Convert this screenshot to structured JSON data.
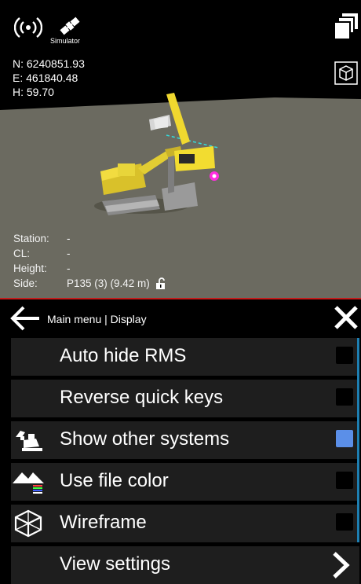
{
  "status": {
    "simulator_label": "Simulator"
  },
  "coords": {
    "n": "N: 6240851.93",
    "e": "E: 461840.48",
    "h": "H: 59.70"
  },
  "info": {
    "station_key": "Station:",
    "station_val": "-",
    "cl_key": "CL:",
    "cl_val": "-",
    "height_key": "Height:",
    "height_val": "-",
    "side_key": "Side:",
    "side_val": "P135 (3) (9.42 m)"
  },
  "menu": {
    "breadcrumb": "Main menu | Display",
    "items": [
      {
        "label": "Auto hide RMS",
        "checked": false
      },
      {
        "label": "Reverse quick keys",
        "checked": false
      },
      {
        "label": "Show other systems",
        "checked": true
      },
      {
        "label": "Use file color",
        "checked": false
      },
      {
        "label": "Wireframe",
        "checked": false
      },
      {
        "label": "View settings"
      }
    ]
  },
  "colors": {
    "accent": "#5b8fe8",
    "ground": "#6b6a60",
    "divider": "#c41b1b",
    "scroll": "#1e7fb2"
  }
}
